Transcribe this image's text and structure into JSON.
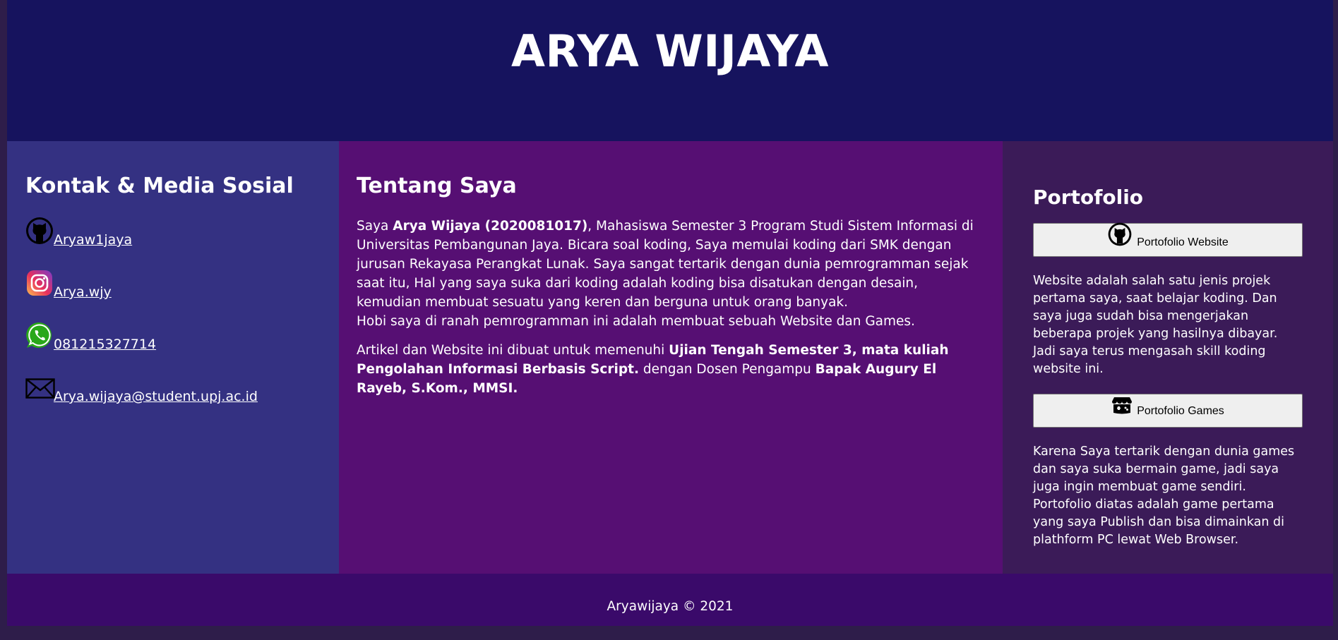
{
  "header": {
    "title": "ARYA WIJAYA"
  },
  "contact": {
    "heading": "Kontak & Media Sosial",
    "items": [
      {
        "icon": "github-icon",
        "label": " Aryaw1jaya"
      },
      {
        "icon": "instagram-icon",
        "label": " Arya.wjy"
      },
      {
        "icon": "whatsapp-icon",
        "label": " 081215327714"
      },
      {
        "icon": "mail-icon",
        "label": "Arya.wijaya@student.upj.ac.id"
      }
    ]
  },
  "about": {
    "heading": "Tentang Saya",
    "p1_pre": "Saya ",
    "p1_bold": "Arya Wijaya (2020081017)",
    "p1_post": ", Mahasiswa Semester 3 Program Studi Sistem Informasi di Universitas Pembangunan Jaya. Bicara soal koding, Saya memulai koding dari SMK dengan jurusan Rekayasa Perangkat Lunak. Saya sangat tertarik dengan dunia pemrogramman sejak saat itu, Hal yang saya suka dari koding adalah koding bisa disatukan dengan desain, kemudian membuat sesuatu yang keren dan berguna untuk orang banyak.",
    "p1_line2": "Hobi saya di ranah pemrogramman ini adalah membuat sebuah Website dan Games.",
    "p2_pre": "Artikel dan Website ini dibuat untuk memenuhi ",
    "p2_bold1": "Ujian Tengah Semester 3, mata kuliah Pengolahan Informasi Berbasis Script.",
    "p2_mid": " dengan Dosen Pengampu ",
    "p2_bold2": "Bapak Augury El Rayeb, S.Kom., MMSI."
  },
  "portfolio": {
    "heading": "Portofolio",
    "website_button": "Portofolio Website",
    "website_desc": "Website adalah salah satu jenis projek pertama saya, saat belajar koding. Dan saya juga sudah bisa mengerjakan beberapa projek yang hasilnya dibayar. Jadi saya terus mengasah skill koding website ini.",
    "games_button": "Portofolio Games",
    "games_desc": "Karena Saya tertarik dengan dunia games dan saya suka bermain game, jadi saya juga ingin membuat game sendiri. Portofolio diatas adalah game pertama yang saya Publish dan bisa dimainkan di plathform PC lewat Web Browser."
  },
  "footer": {
    "text": "Aryawijaya © 2021"
  }
}
